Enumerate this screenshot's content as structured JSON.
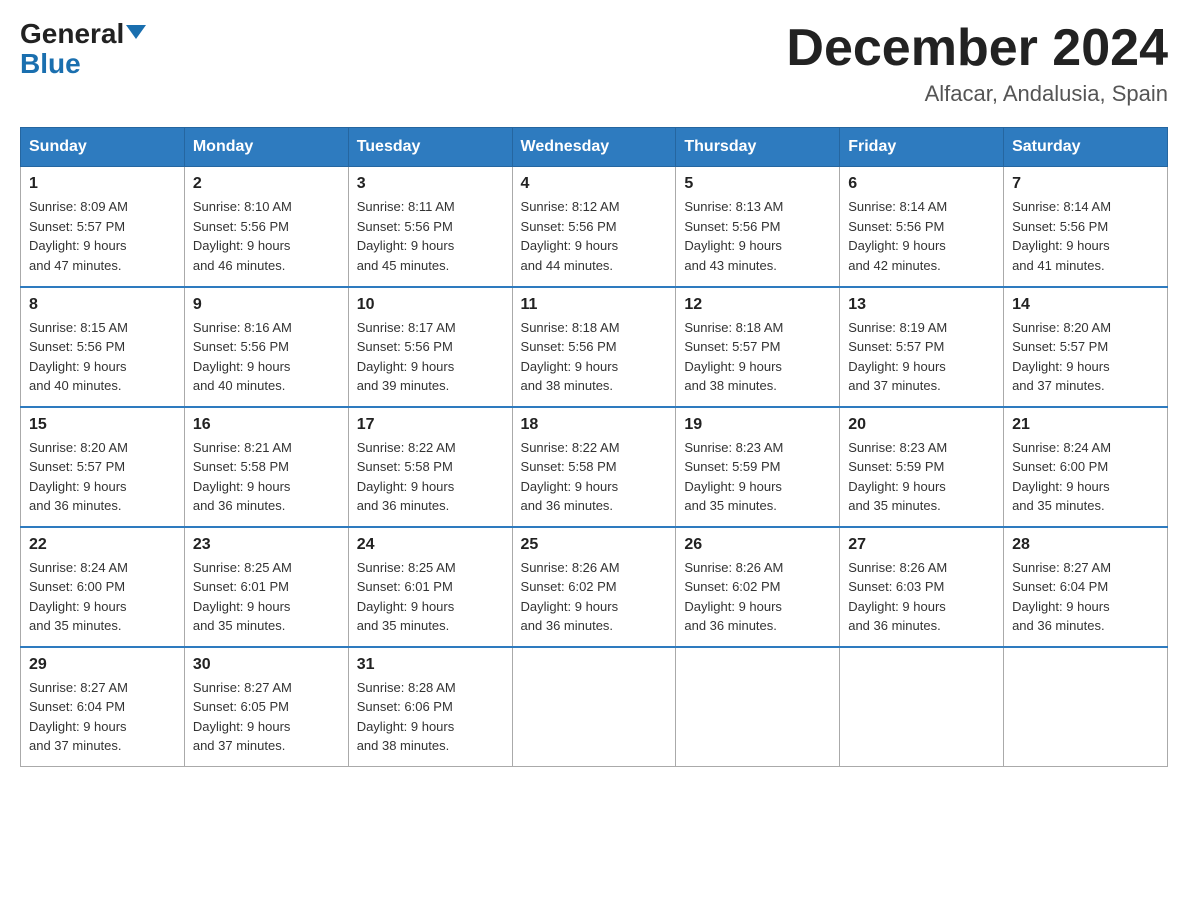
{
  "header": {
    "logo_general": "General",
    "logo_blue": "Blue",
    "month": "December 2024",
    "location": "Alfacar, Andalusia, Spain"
  },
  "days_of_week": [
    "Sunday",
    "Monday",
    "Tuesday",
    "Wednesday",
    "Thursday",
    "Friday",
    "Saturday"
  ],
  "weeks": [
    [
      {
        "day": "1",
        "sunrise": "8:09 AM",
        "sunset": "5:57 PM",
        "daylight": "9 hours and 47 minutes."
      },
      {
        "day": "2",
        "sunrise": "8:10 AM",
        "sunset": "5:56 PM",
        "daylight": "9 hours and 46 minutes."
      },
      {
        "day": "3",
        "sunrise": "8:11 AM",
        "sunset": "5:56 PM",
        "daylight": "9 hours and 45 minutes."
      },
      {
        "day": "4",
        "sunrise": "8:12 AM",
        "sunset": "5:56 PM",
        "daylight": "9 hours and 44 minutes."
      },
      {
        "day": "5",
        "sunrise": "8:13 AM",
        "sunset": "5:56 PM",
        "daylight": "9 hours and 43 minutes."
      },
      {
        "day": "6",
        "sunrise": "8:14 AM",
        "sunset": "5:56 PM",
        "daylight": "9 hours and 42 minutes."
      },
      {
        "day": "7",
        "sunrise": "8:14 AM",
        "sunset": "5:56 PM",
        "daylight": "9 hours and 41 minutes."
      }
    ],
    [
      {
        "day": "8",
        "sunrise": "8:15 AM",
        "sunset": "5:56 PM",
        "daylight": "9 hours and 40 minutes."
      },
      {
        "day": "9",
        "sunrise": "8:16 AM",
        "sunset": "5:56 PM",
        "daylight": "9 hours and 40 minutes."
      },
      {
        "day": "10",
        "sunrise": "8:17 AM",
        "sunset": "5:56 PM",
        "daylight": "9 hours and 39 minutes."
      },
      {
        "day": "11",
        "sunrise": "8:18 AM",
        "sunset": "5:56 PM",
        "daylight": "9 hours and 38 minutes."
      },
      {
        "day": "12",
        "sunrise": "8:18 AM",
        "sunset": "5:57 PM",
        "daylight": "9 hours and 38 minutes."
      },
      {
        "day": "13",
        "sunrise": "8:19 AM",
        "sunset": "5:57 PM",
        "daylight": "9 hours and 37 minutes."
      },
      {
        "day": "14",
        "sunrise": "8:20 AM",
        "sunset": "5:57 PM",
        "daylight": "9 hours and 37 minutes."
      }
    ],
    [
      {
        "day": "15",
        "sunrise": "8:20 AM",
        "sunset": "5:57 PM",
        "daylight": "9 hours and 36 minutes."
      },
      {
        "day": "16",
        "sunrise": "8:21 AM",
        "sunset": "5:58 PM",
        "daylight": "9 hours and 36 minutes."
      },
      {
        "day": "17",
        "sunrise": "8:22 AM",
        "sunset": "5:58 PM",
        "daylight": "9 hours and 36 minutes."
      },
      {
        "day": "18",
        "sunrise": "8:22 AM",
        "sunset": "5:58 PM",
        "daylight": "9 hours and 36 minutes."
      },
      {
        "day": "19",
        "sunrise": "8:23 AM",
        "sunset": "5:59 PM",
        "daylight": "9 hours and 35 minutes."
      },
      {
        "day": "20",
        "sunrise": "8:23 AM",
        "sunset": "5:59 PM",
        "daylight": "9 hours and 35 minutes."
      },
      {
        "day": "21",
        "sunrise": "8:24 AM",
        "sunset": "6:00 PM",
        "daylight": "9 hours and 35 minutes."
      }
    ],
    [
      {
        "day": "22",
        "sunrise": "8:24 AM",
        "sunset": "6:00 PM",
        "daylight": "9 hours and 35 minutes."
      },
      {
        "day": "23",
        "sunrise": "8:25 AM",
        "sunset": "6:01 PM",
        "daylight": "9 hours and 35 minutes."
      },
      {
        "day": "24",
        "sunrise": "8:25 AM",
        "sunset": "6:01 PM",
        "daylight": "9 hours and 35 minutes."
      },
      {
        "day": "25",
        "sunrise": "8:26 AM",
        "sunset": "6:02 PM",
        "daylight": "9 hours and 36 minutes."
      },
      {
        "day": "26",
        "sunrise": "8:26 AM",
        "sunset": "6:02 PM",
        "daylight": "9 hours and 36 minutes."
      },
      {
        "day": "27",
        "sunrise": "8:26 AM",
        "sunset": "6:03 PM",
        "daylight": "9 hours and 36 minutes."
      },
      {
        "day": "28",
        "sunrise": "8:27 AM",
        "sunset": "6:04 PM",
        "daylight": "9 hours and 36 minutes."
      }
    ],
    [
      {
        "day": "29",
        "sunrise": "8:27 AM",
        "sunset": "6:04 PM",
        "daylight": "9 hours and 37 minutes."
      },
      {
        "day": "30",
        "sunrise": "8:27 AM",
        "sunset": "6:05 PM",
        "daylight": "9 hours and 37 minutes."
      },
      {
        "day": "31",
        "sunrise": "8:28 AM",
        "sunset": "6:06 PM",
        "daylight": "9 hours and 38 minutes."
      },
      null,
      null,
      null,
      null
    ]
  ]
}
